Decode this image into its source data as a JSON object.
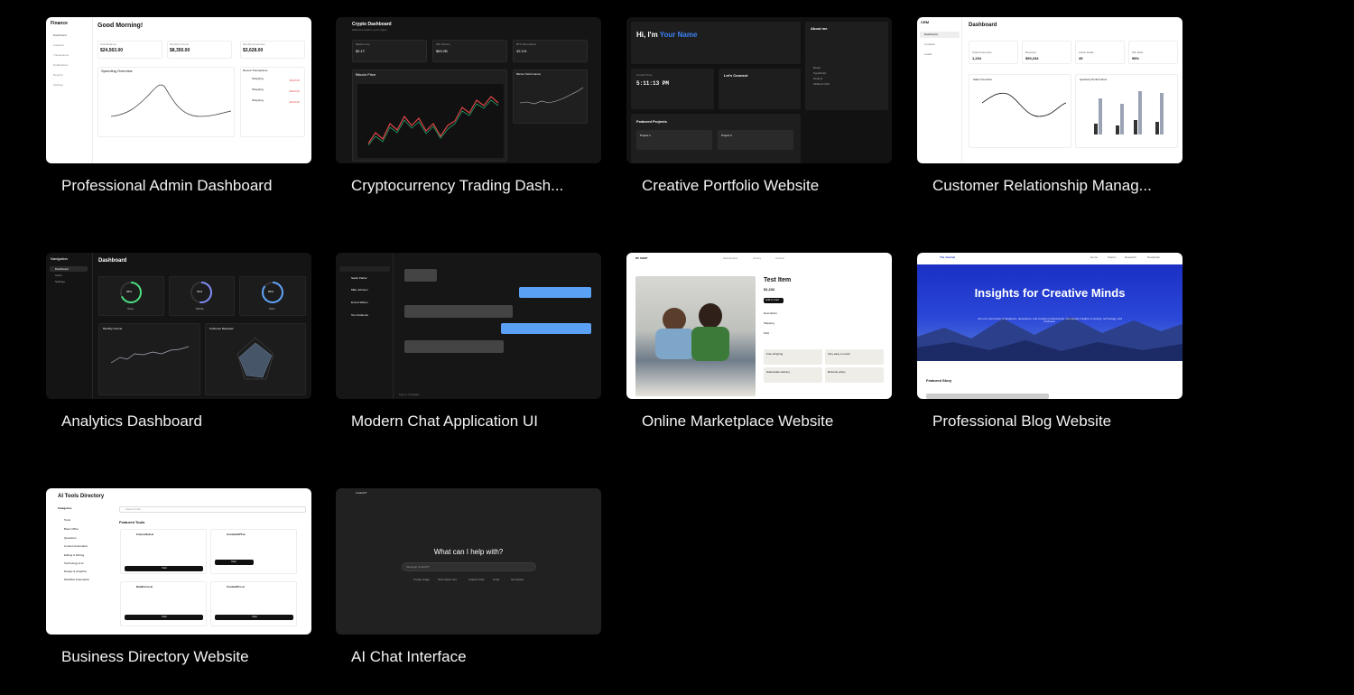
{
  "templates": [
    {
      "title": "Professional Admin Dashboard"
    },
    {
      "title": "Cryptocurrency Trading Dash..."
    },
    {
      "title": "Creative Portfolio Website"
    },
    {
      "title": "Customer Relationship Manag..."
    },
    {
      "title": "Analytics Dashboard"
    },
    {
      "title": "Modern Chat Application UI"
    },
    {
      "title": "Online Marketplace Website"
    },
    {
      "title": "Professional Blog Website"
    },
    {
      "title": "Business Directory Website"
    },
    {
      "title": "AI Chat Interface"
    }
  ],
  "admin": {
    "brand": "Finance",
    "greeting": "Good Morning!",
    "nav": [
      "Dashboard",
      "Analytics",
      "Transactions",
      "Notifications",
      "Reports",
      "Settings"
    ],
    "stats": [
      {
        "label": "Total Balance",
        "value": "$24,563.00"
      },
      {
        "label": "Monthly Income",
        "value": "$8,350.00"
      },
      {
        "label": "Monthly Expenses",
        "value": "$3,628.00"
      }
    ],
    "chart_title": "Spending Overview",
    "recent_title": "Recent Transactions",
    "transactions": [
      {
        "name": "Shopping",
        "amount": "-$120.00"
      },
      {
        "name": "Shopping",
        "amount": "-$120.00"
      },
      {
        "name": "Shopping",
        "amount": "-$120.00"
      }
    ]
  },
  "crypto": {
    "title": "Crypto Dashboard",
    "subtitle": "Welcome back to your crypto",
    "stats": [
      {
        "label": "Market Cap",
        "value": "$2.1T"
      },
      {
        "label": "24h Volume",
        "value": "$83.2B"
      },
      {
        "label": "BTC Dominance",
        "value": "42.1%"
      }
    ],
    "chart1": "Bitcoin Price",
    "chart2": "Bitcoin Performance"
  },
  "portfolio": {
    "hi": "Hi, I'm ",
    "name": "Your Name",
    "about": "About me",
    "time_label": "Current Time",
    "time": "5:11:13 PM",
    "connect": "Let's Connect",
    "projects_title": "Featured Projects",
    "projects": [
      "Project 1",
      "Project 2"
    ],
    "skills": [
      "React",
      "TypeScript",
      "Node.js",
      "Tailwind CSS"
    ]
  },
  "crm": {
    "brand": "CRM",
    "title": "Dashboard",
    "nav": [
      "Dashboard",
      "Contacts",
      "Leads"
    ],
    "stats": [
      {
        "label": "Total Customers",
        "value": "1,234"
      },
      {
        "label": "Revenue",
        "value": "$50,234"
      },
      {
        "label": "Active Deals",
        "value": "45"
      },
      {
        "label": "Win Rate",
        "value": "58%"
      }
    ],
    "chart1": "Sales Overview",
    "chart2": "Quarterly Performance"
  },
  "analytics": {
    "nav_title": "Navigation",
    "nav": [
      "Dashboard",
      "Users",
      "Settings"
    ],
    "title": "Dashboard",
    "gauges": [
      {
        "label": "Shop",
        "value": "68%"
      },
      {
        "label": "Mobile",
        "value": "52%"
      },
      {
        "label": "Kiths",
        "value": "85%"
      }
    ],
    "chart1": "Monthly Income",
    "chart2": "Customer Requests"
  },
  "chat": {
    "contacts": [
      "Sarah Parker",
      "Mike Johnson",
      "Emma Wilson",
      "Tom Anderson"
    ],
    "input_placeholder": "Type a message..."
  },
  "market": {
    "brand": "RZ SHOP",
    "nav": [
      "Marketplace",
      "Library",
      "Upload"
    ],
    "item": "Test Item",
    "price": "$1,232",
    "button": "Add to Cart",
    "sections": [
      "Description",
      "Shipping",
      "FAQ"
    ],
    "features": [
      "Free shipping",
      "Very easy to return",
      "Nationwide delivery",
      "Refunds policy"
    ]
  },
  "blog": {
    "brand": "The Journal",
    "nav": [
      "Home",
      "Stories",
      "Research",
      "Newsletter"
    ],
    "hero_title": "Insights for Creative Minds",
    "hero_sub": "Join our community of designers, developers, and creative professionals. Get weekly insights on design, technology, and business.",
    "featured": "Featured Story"
  },
  "directory": {
    "title": "AI Tools Directory",
    "search": "Search tools...",
    "categories_title": "Categories",
    "categories": [
      "Tools",
      "Basic Office",
      "Questions",
      "Content Automation",
      "Editing & Writing",
      "Technology & AI",
      "Design & Graphics",
      "Workflow Automation"
    ],
    "featured": "Featured Tools",
    "tools": [
      {
        "name": "FusionHub.ai",
        "visit": "Visit"
      },
      {
        "name": "ContentGPT.ai",
        "visit": "Visit"
      },
      {
        "name": "DataForce.ai",
        "visit": "Visit"
      },
      {
        "name": "ContentPro.ai",
        "visit": "Visit"
      }
    ]
  },
  "aichat": {
    "model": "ChatGPT",
    "question": "What can I help with?",
    "placeholder": "Message ChatGPT",
    "chips": [
      "Create image",
      "Summarize text",
      "Analyze data",
      "Code",
      "Get advice"
    ]
  },
  "colors": {
    "accent_blue": "#3b82f6",
    "blog_blue": "#1f33c9",
    "negative_red": "#e04646"
  }
}
